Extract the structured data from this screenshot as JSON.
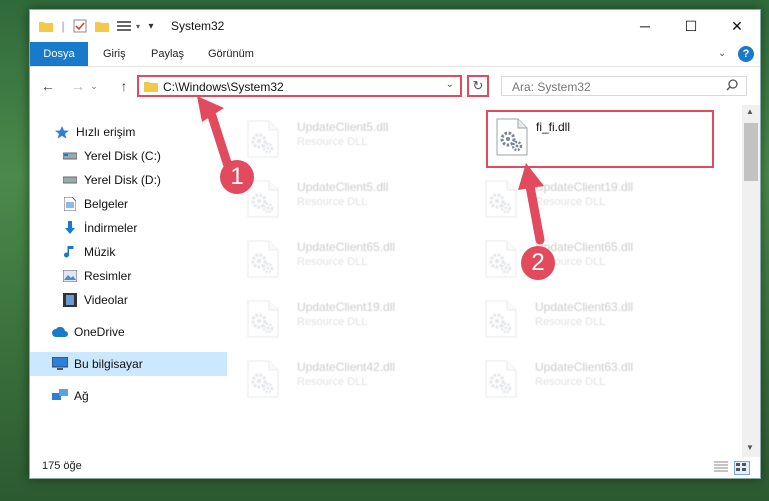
{
  "window": {
    "title": "System32"
  },
  "ribbon": {
    "tabs": [
      {
        "label": "Dosya",
        "active": true
      },
      {
        "label": "Giriş"
      },
      {
        "label": "Paylaş"
      },
      {
        "label": "Görünüm"
      }
    ]
  },
  "address": {
    "path": "C:\\Windows\\System32"
  },
  "search": {
    "placeholder": "Ara: System32"
  },
  "sidebar": {
    "quick_access": "Hızlı erişim",
    "items": [
      {
        "label": "Yerel Disk (C:)"
      },
      {
        "label": "Yerel Disk (D:)"
      },
      {
        "label": "Belgeler"
      },
      {
        "label": "İndirmeler"
      },
      {
        "label": "Müzik"
      },
      {
        "label": "Resimler"
      },
      {
        "label": "Videolar"
      }
    ],
    "onedrive": "OneDrive",
    "this_pc": "Bu bilgisayar",
    "network": "Ağ"
  },
  "files": [
    {
      "name": "UpdateClient5.dll",
      "type": "Resource DLL"
    },
    {
      "name": "fi_fi.dll",
      "type": ""
    },
    {
      "name": "UpdateClient5.dll",
      "type": "Resource DLL"
    },
    {
      "name": "UpdateClient19.dll",
      "type": "Resource DLL"
    },
    {
      "name": "UpdateClient65.dll",
      "type": "Resource DLL"
    },
    {
      "name": "UpdateClient65.dll",
      "type": "Resource DLL"
    },
    {
      "name": "UpdateClient19.dll",
      "type": "Resource DLL"
    },
    {
      "name": "UpdateClient63.dll",
      "type": "Resource DLL"
    },
    {
      "name": "UpdateClient42.dll",
      "type": "Resource DLL"
    },
    {
      "name": "UpdateClient63.dll",
      "type": "Resource DLL"
    }
  ],
  "status": {
    "count": "175 öğe"
  },
  "callouts": [
    "1",
    "2"
  ],
  "colors": {
    "accent": "#1979ca",
    "highlight": "#e24a5d",
    "selected": "#cce8ff"
  }
}
